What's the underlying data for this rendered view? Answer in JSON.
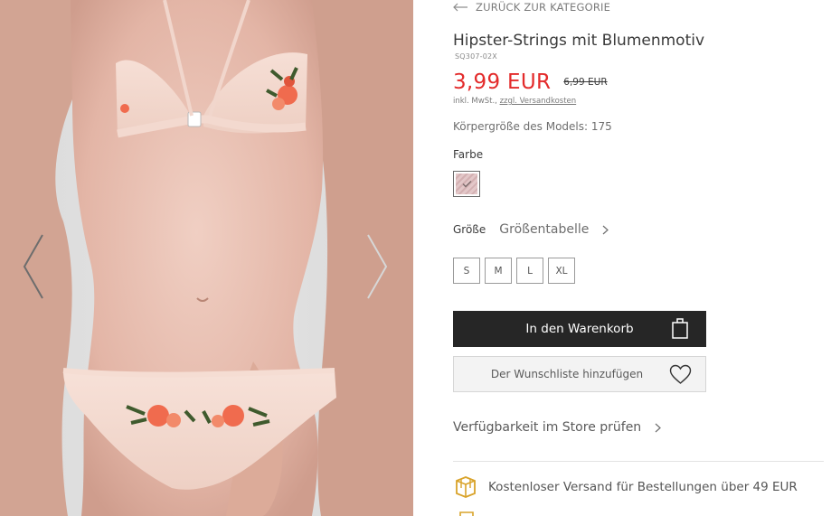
{
  "navigation": {
    "back_label": "ZURÜCK ZUR KATEGORIE"
  },
  "gallery": {
    "prev_icon": "chevron-left-icon",
    "next_icon": "chevron-right-icon"
  },
  "product": {
    "title": "Hipster-Strings mit Blumenmotiv",
    "sku": "SQ307-02X",
    "price_current": "3,99 EUR",
    "price_old": "6,99 EUR",
    "tax_prefix": "inkl. MwSt., ",
    "tax_link": "zzgl. Versandkosten",
    "model_info": "Körpergröße des Models: 175",
    "color_label": "Farbe",
    "size_label": "Größe",
    "size_chart_label": "Größentabelle",
    "sizes": [
      "S",
      "M",
      "L",
      "XL"
    ]
  },
  "actions": {
    "add_to_cart": "In den Warenkorb",
    "add_to_wishlist": "Der Wunschliste hinzufügen",
    "store_availability": "Verfügbarkeit im Store prüfen"
  },
  "info": {
    "free_shipping": "Kostenloser Versand für Bestellungen über 49 EUR"
  },
  "colors": {
    "price_accent": "#e32b2b",
    "button_dark": "#262626",
    "icon_gold": "#d9a32a",
    "swatch": "#dcbcbe"
  }
}
